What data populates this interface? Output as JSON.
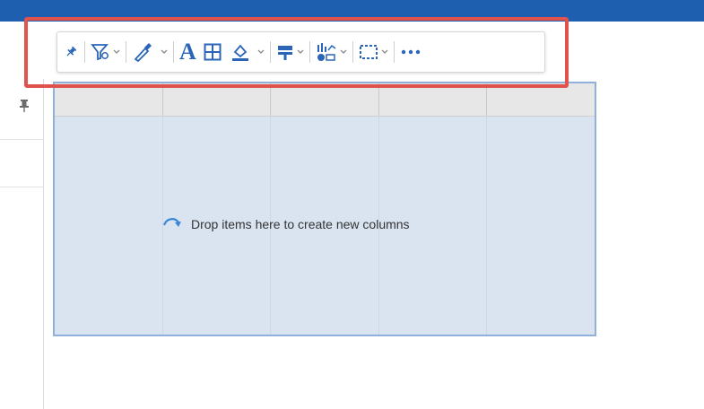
{
  "canvas": {
    "drop_message": "Drop items here to create new columns",
    "column_count": 5
  },
  "toolbar": {
    "items": [
      {
        "name": "pin",
        "icon": "pin-icon"
      },
      {
        "name": "filter",
        "icon": "filter-icon",
        "dropdown": true
      },
      {
        "name": "eyedropper",
        "icon": "eyedropper-icon",
        "dropdown": true
      },
      {
        "name": "text-format",
        "icon": "text-format-icon",
        "label": "A"
      },
      {
        "name": "borders",
        "icon": "borders-icon"
      },
      {
        "name": "fill-color",
        "icon": "fill-color-icon",
        "dropdown": true
      },
      {
        "name": "alignment",
        "icon": "alignment-icon",
        "dropdown": true
      },
      {
        "name": "visualization",
        "icon": "visualization-icon",
        "dropdown": true
      },
      {
        "name": "selection-frame",
        "icon": "selection-frame-icon",
        "dropdown": true
      },
      {
        "name": "more",
        "icon": "more-icon"
      }
    ]
  },
  "colors": {
    "accent": "#1f5fb0",
    "highlight": "#e0534d",
    "drop_zone": "#dae4f0",
    "icon": "#2a65b8"
  }
}
